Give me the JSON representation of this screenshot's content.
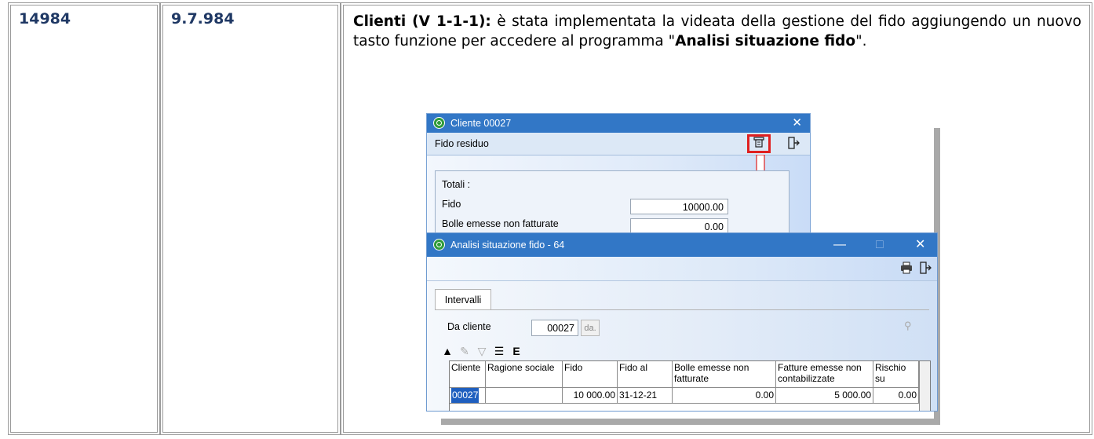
{
  "row": {
    "code": "14984",
    "version": "9.7.984",
    "desc_title": "Clienti (V 1-1-1):",
    "desc_text_1": " è stata implementata la videata della gestione del fido aggiungendo un nuovo tasto funzione per accedere al  programma \"",
    "desc_bold": "Analisi situazione fido",
    "desc_text_2": "\"."
  },
  "cliente_window": {
    "title": "Cliente 00027",
    "close": "✕",
    "toolbar_label": "Fido residuo",
    "icons": [
      "fido-analysis-icon",
      "exit-door-icon"
    ],
    "totals_label": "Totali :",
    "fields": [
      {
        "label": "Fido",
        "value": "10000.00"
      },
      {
        "label": "Bolle emesse non fatturate",
        "value": "0.00"
      }
    ]
  },
  "analisi_window": {
    "title": "Analisi situazione fido - 64",
    "controls": {
      "minimize": "—",
      "maximize": "□",
      "close": "✕"
    },
    "icons": [
      "print-icon",
      "exit-door-icon"
    ],
    "tab_label": "Intervalli",
    "da_cliente_label": "Da cliente",
    "da_cliente_value": "00027",
    "da_button": "da.",
    "grid": {
      "columns": [
        "Cliente",
        "Ragione sociale",
        "Fido",
        "Fido al",
        "Bolle emesse non fatturate",
        "Fatture emesse non contabilizzate",
        "Rischio su"
      ],
      "rows": [
        {
          "cliente": "00027",
          "ragione_sociale": "",
          "fido": "10 000.00",
          "fido_al": "31-12-21",
          "bolle": "0.00",
          "fatture": "5 000.00",
          "rischio": "0.00"
        }
      ]
    }
  },
  "colors": {
    "title_blue": "#3277c6",
    "highlight_red": "#e02020",
    "heading_navy": "#1f3864"
  }
}
